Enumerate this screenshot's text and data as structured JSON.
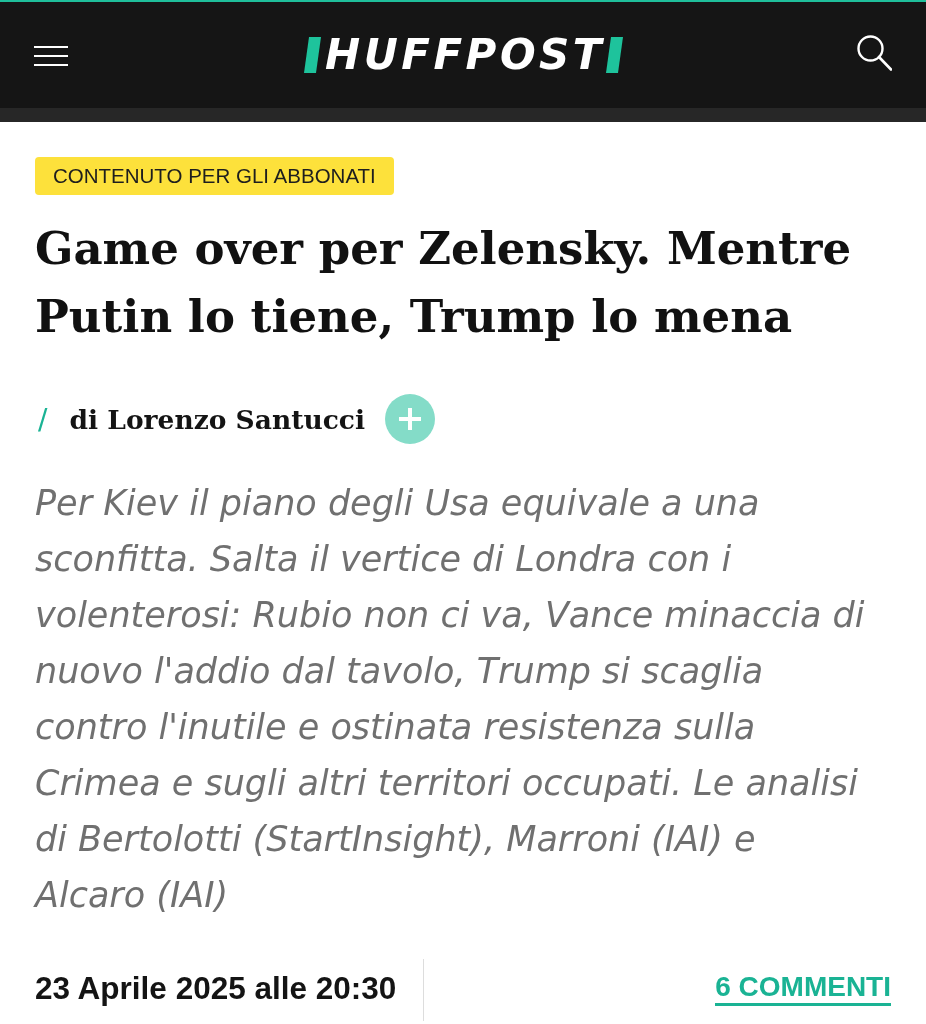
{
  "header": {
    "logo": "HUFFPOST"
  },
  "article": {
    "badge": "CONTENUTO PER GLI ABBONATI",
    "title": "Game over per Zelensky. Mentre Putin lo tiene, Trump lo mena",
    "byline": {
      "separator": "/",
      "author": "di Lorenzo Santucci"
    },
    "summary": "Per Kiev il piano degli Usa equivale a una sconfitta. Salta il vertice di Londra con i volenterosi: Rubio non ci va, Vance minaccia di nuovo l'addio dal tavolo, Trump si scaglia contro l'inutile e ostinata resistenza sulla Crimea e sugli altri territori occupati. Le analisi di Bertolotti (StartInsight), Marroni (IAI) e Alcaro (IAI)",
    "date": "23 Aprile 2025 alle 20:30",
    "comments_link": "6 COMMENTI"
  }
}
